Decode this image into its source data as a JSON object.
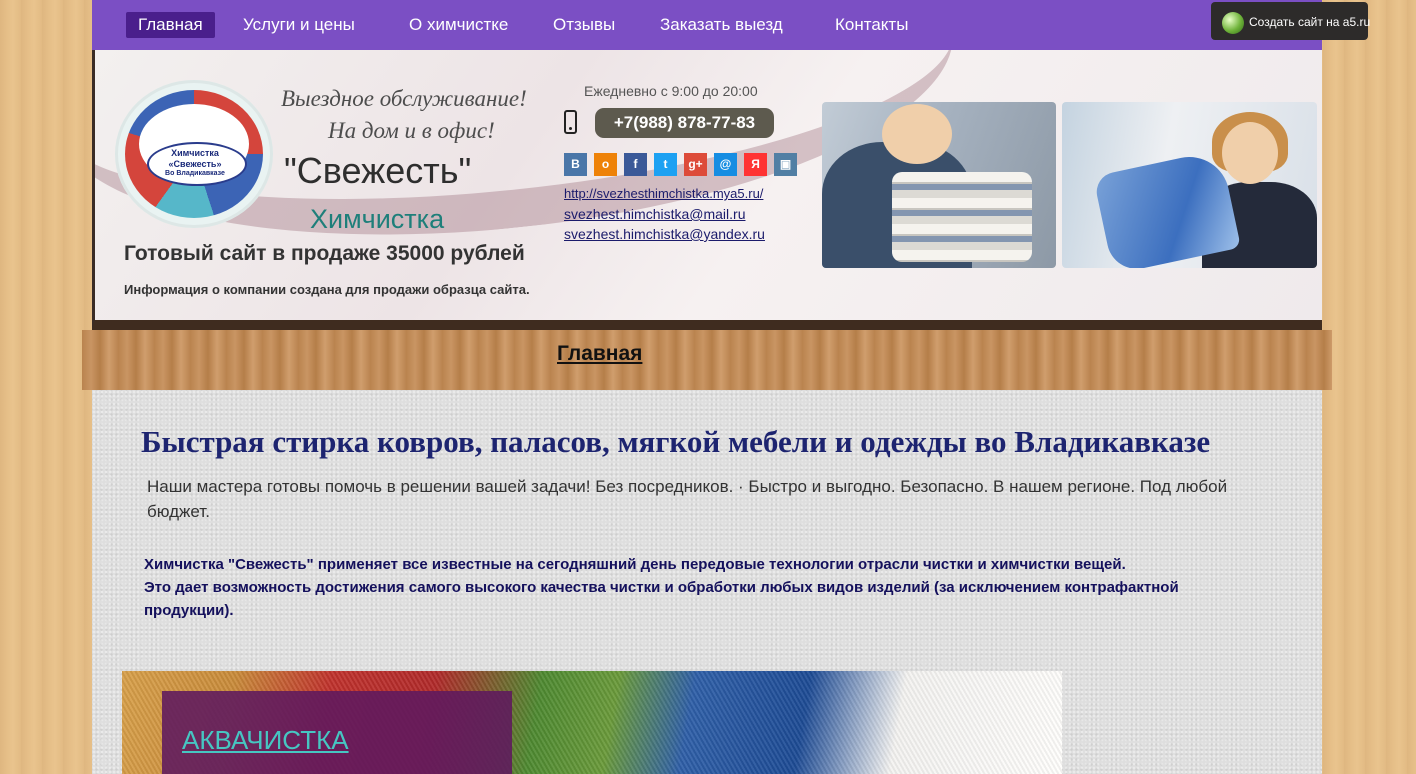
{
  "nav": {
    "items": [
      {
        "label": "Главная",
        "active": true
      },
      {
        "label": "Услуги и цены",
        "active": false
      },
      {
        "label": "О химчистке",
        "active": false
      },
      {
        "label": "Отзывы",
        "active": false
      },
      {
        "label": "Заказать выезд",
        "active": false
      },
      {
        "label": "Контакты",
        "active": false
      }
    ]
  },
  "a5_badge": {
    "label": "Создать сайт на a5.ru"
  },
  "header": {
    "logo": {
      "line1": "Химчистка",
      "line2": "«Свежесть»",
      "line3": "Во Владикавказе"
    },
    "slogan_line1": "Выездное обслуживание!",
    "slogan_line2": "На дом и в офис!",
    "brand": "\"Свежесть\"",
    "subtitle": "Химчистка",
    "sale": "Готовый сайт в продаже 35000 рублей",
    "info": "Информация о компании  создана для продажи образца сайта.",
    "hours": "Ежедневно с 9:00 до 20:00",
    "phone": "+7(988) 878-77-83",
    "socials": [
      {
        "icon": "vk-icon",
        "glyph": "В",
        "color": "#4a76a8"
      },
      {
        "icon": "odnoklassniki-icon",
        "glyph": "о",
        "color": "#ee8208"
      },
      {
        "icon": "facebook-icon",
        "glyph": "f",
        "color": "#3b5998"
      },
      {
        "icon": "twitter-icon",
        "glyph": "t",
        "color": "#1da1f2"
      },
      {
        "icon": "google-plus-icon",
        "glyph": "g+",
        "color": "#dd4b39"
      },
      {
        "icon": "mail-ru-icon",
        "glyph": "@",
        "color": "#168de2"
      },
      {
        "icon": "yandex-icon",
        "glyph": "Я",
        "color": "#f33"
      },
      {
        "icon": "instagram-icon",
        "glyph": "▣",
        "color": "#517fa4"
      }
    ],
    "links": {
      "site": "http://svezhesthimchistka.mya5.ru/",
      "email1": "svezhest.himchistka@mail.ru ",
      "email2": "svezhest.himchistka@yandex.ru "
    }
  },
  "breadcrumb": {
    "label": "Главная"
  },
  "main": {
    "heading": "Быстрая стирка ковров, паласов, мягкой мебели и одежды во Владикавказе",
    "intro": "Наши  мастера готовы помочь в решении вашей задачи! Без посредников. · Быстро и выгодно. Безопасно. В нашем регионе. Под любой бюджет.",
    "desc_line1": "Химчистка \"Свежесть\" применяет все известные на сегодняшний день передовые технологии отрасли чистки и химчистки вещей.",
    "desc_line2": "Это дает возможность достижения самого высокого качества чистки и обработки любых видов изделий  (за исключением контрафактной продукции).",
    "banner_link": "АКВАЧИСТКА"
  }
}
